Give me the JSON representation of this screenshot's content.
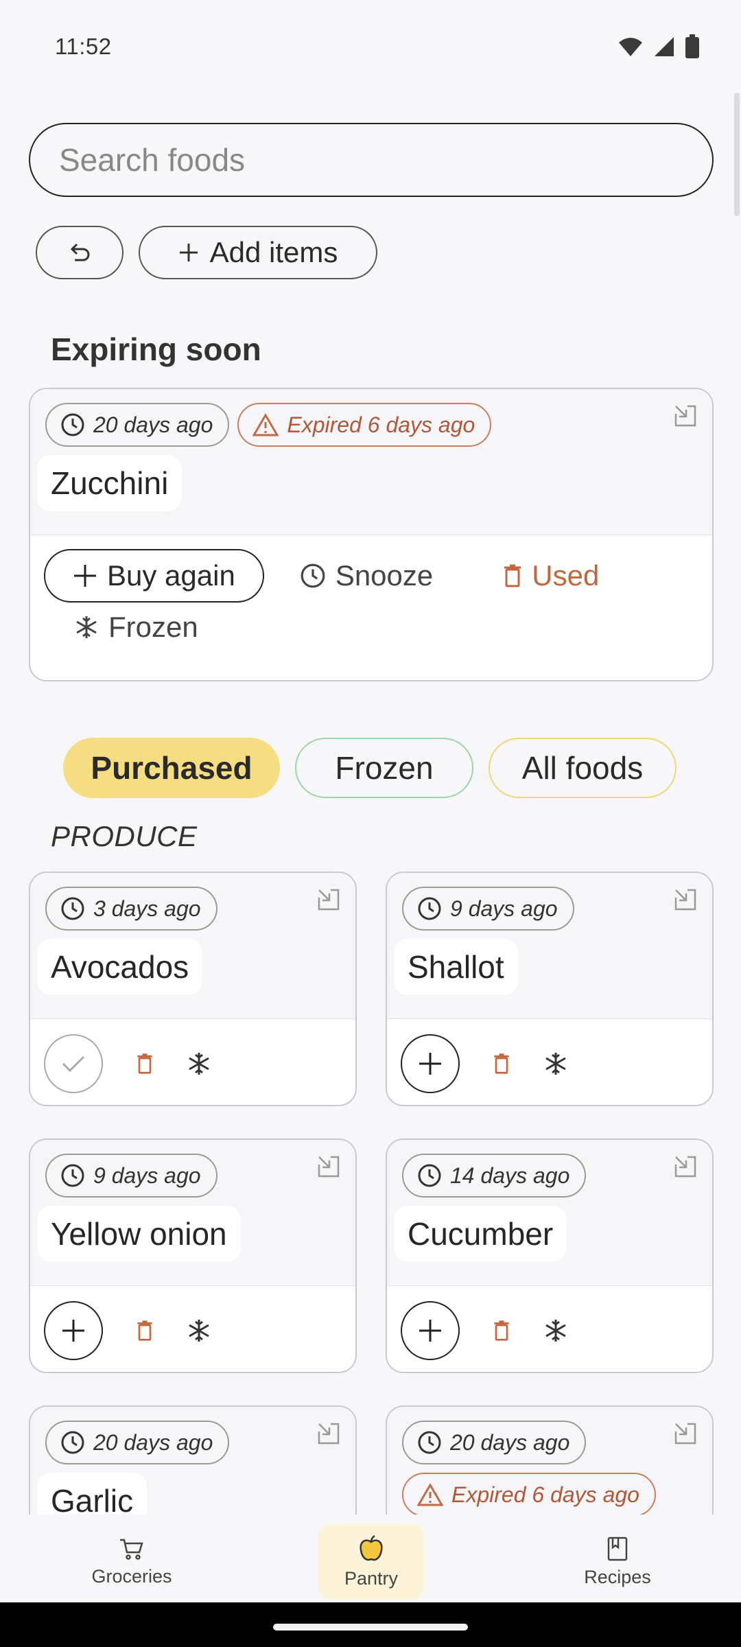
{
  "status": {
    "time": "11:52"
  },
  "search": {
    "placeholder": "Search foods"
  },
  "toolbar": {
    "add_label": "Add items"
  },
  "expiring": {
    "title": "Expiring soon",
    "card": {
      "purchased": "20 days ago",
      "expired": "Expired 6 days ago",
      "name": "Zucchini",
      "actions": {
        "buy_again": "Buy again",
        "snooze": "Snooze",
        "used": "Used",
        "frozen": "Frozen"
      }
    }
  },
  "filters": [
    "Purchased",
    "Frozen",
    "All foods"
  ],
  "category": "PRODUCE",
  "items": [
    {
      "name": "Avocados",
      "purchased": "3 days ago"
    },
    {
      "name": "Shallot",
      "purchased": "9 days ago"
    },
    {
      "name": "Yellow onion",
      "purchased": "9 days ago"
    },
    {
      "name": "Cucumber",
      "purchased": "14 days ago"
    },
    {
      "name": "Garlic",
      "purchased": "20 days ago"
    },
    {
      "name": "",
      "purchased": "20 days ago",
      "expired": "Expired 6 days ago"
    }
  ],
  "nav": {
    "groceries": "Groceries",
    "pantry": "Pantry",
    "recipes": "Recipes"
  },
  "colors": {
    "accent": "#f6dd82",
    "warning": "#b2583a",
    "frozen_border": "#9fd3a9"
  }
}
